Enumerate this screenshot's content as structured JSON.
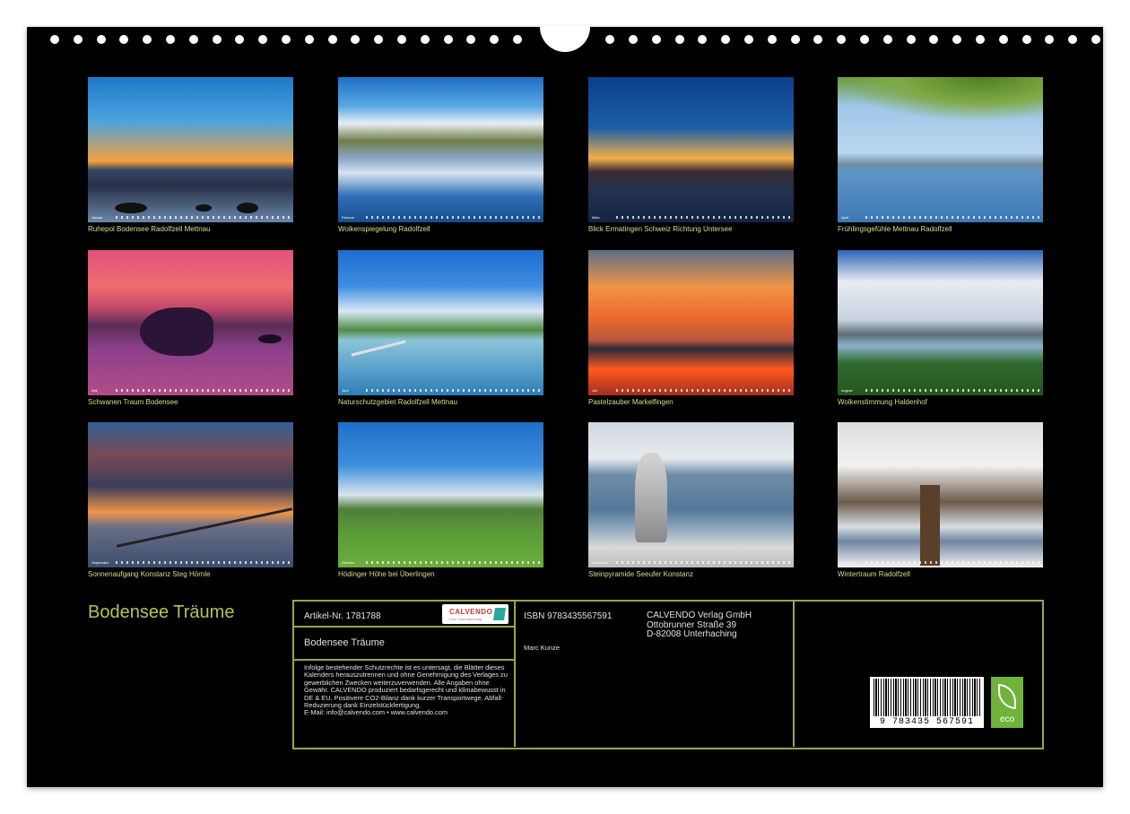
{
  "calendar": {
    "title": "Bodensee Träume",
    "photos": [
      {
        "caption": "Ruhepol Bodensee Radolfzell Mettnau",
        "month": "Januar"
      },
      {
        "caption": "Wolkenspiegelung Radolfzell",
        "month": "Februar"
      },
      {
        "caption": "Blick Ermatingen Schweiz Richtung Untersee",
        "month": "März"
      },
      {
        "caption": "Frühlingsgefühle Mettnau Radolfzell",
        "month": "April"
      },
      {
        "caption": "Schwanen Traum Bodensee",
        "month": "Mai"
      },
      {
        "caption": "Naturschutzgebiet Radolfzell Mettnau",
        "month": "Juni"
      },
      {
        "caption": "Pastelzauber Markelfingen",
        "month": "Juli"
      },
      {
        "caption": "Wolkenstimmung Haldenhof",
        "month": "August"
      },
      {
        "caption": "Sonnenaufgang Konstanz Steg Hörnle",
        "month": "September"
      },
      {
        "caption": "Hödinger Höhe bei Überlingen",
        "month": "Oktober"
      },
      {
        "caption": "Steinpyramide Seeufer Konstanz",
        "month": "November"
      },
      {
        "caption": "Wintertraum Radolfzell",
        "month": "Dezember"
      }
    ]
  },
  "info": {
    "article": "Artikel-Nr. 1781788",
    "product_title": "Bodensee Träume",
    "legal": "Infolge bestehender Schutzrechte ist es untersagt, die Blätter dieses Kalenders herauszutrennen und ohne Genehmigung des Verlages zu gewerblichen Zwecken weiterzuverwenden. Alle Angaben ohne Gewähr. CALVENDO produziert bedarfsgerecht und klimabewusst in DE & EU. Positivere CO2-Bilanz dank kurzer Transportwege. Abfall-Reduzierung dank Einzelstückfertigung.",
    "email": "E-Mail: info@calvendo.com • www.calvendo.com",
    "isbn": "ISBN 9783435567591",
    "author": "Marc Kunze",
    "publisher": [
      "CALVENDO Verlag GmbH",
      "Ottobrunner Straße 39",
      "D-82008 Unterhaching"
    ],
    "logo": "CALVENDO",
    "logo_sub": "Dein Kalenderverlag",
    "barcode_number": "9 783435 567591",
    "eco_label": "eco"
  },
  "colors": {
    "background": "#000000",
    "caption": "#d8dd8e",
    "title": "#b6c15a",
    "border": "#9aa64a"
  }
}
